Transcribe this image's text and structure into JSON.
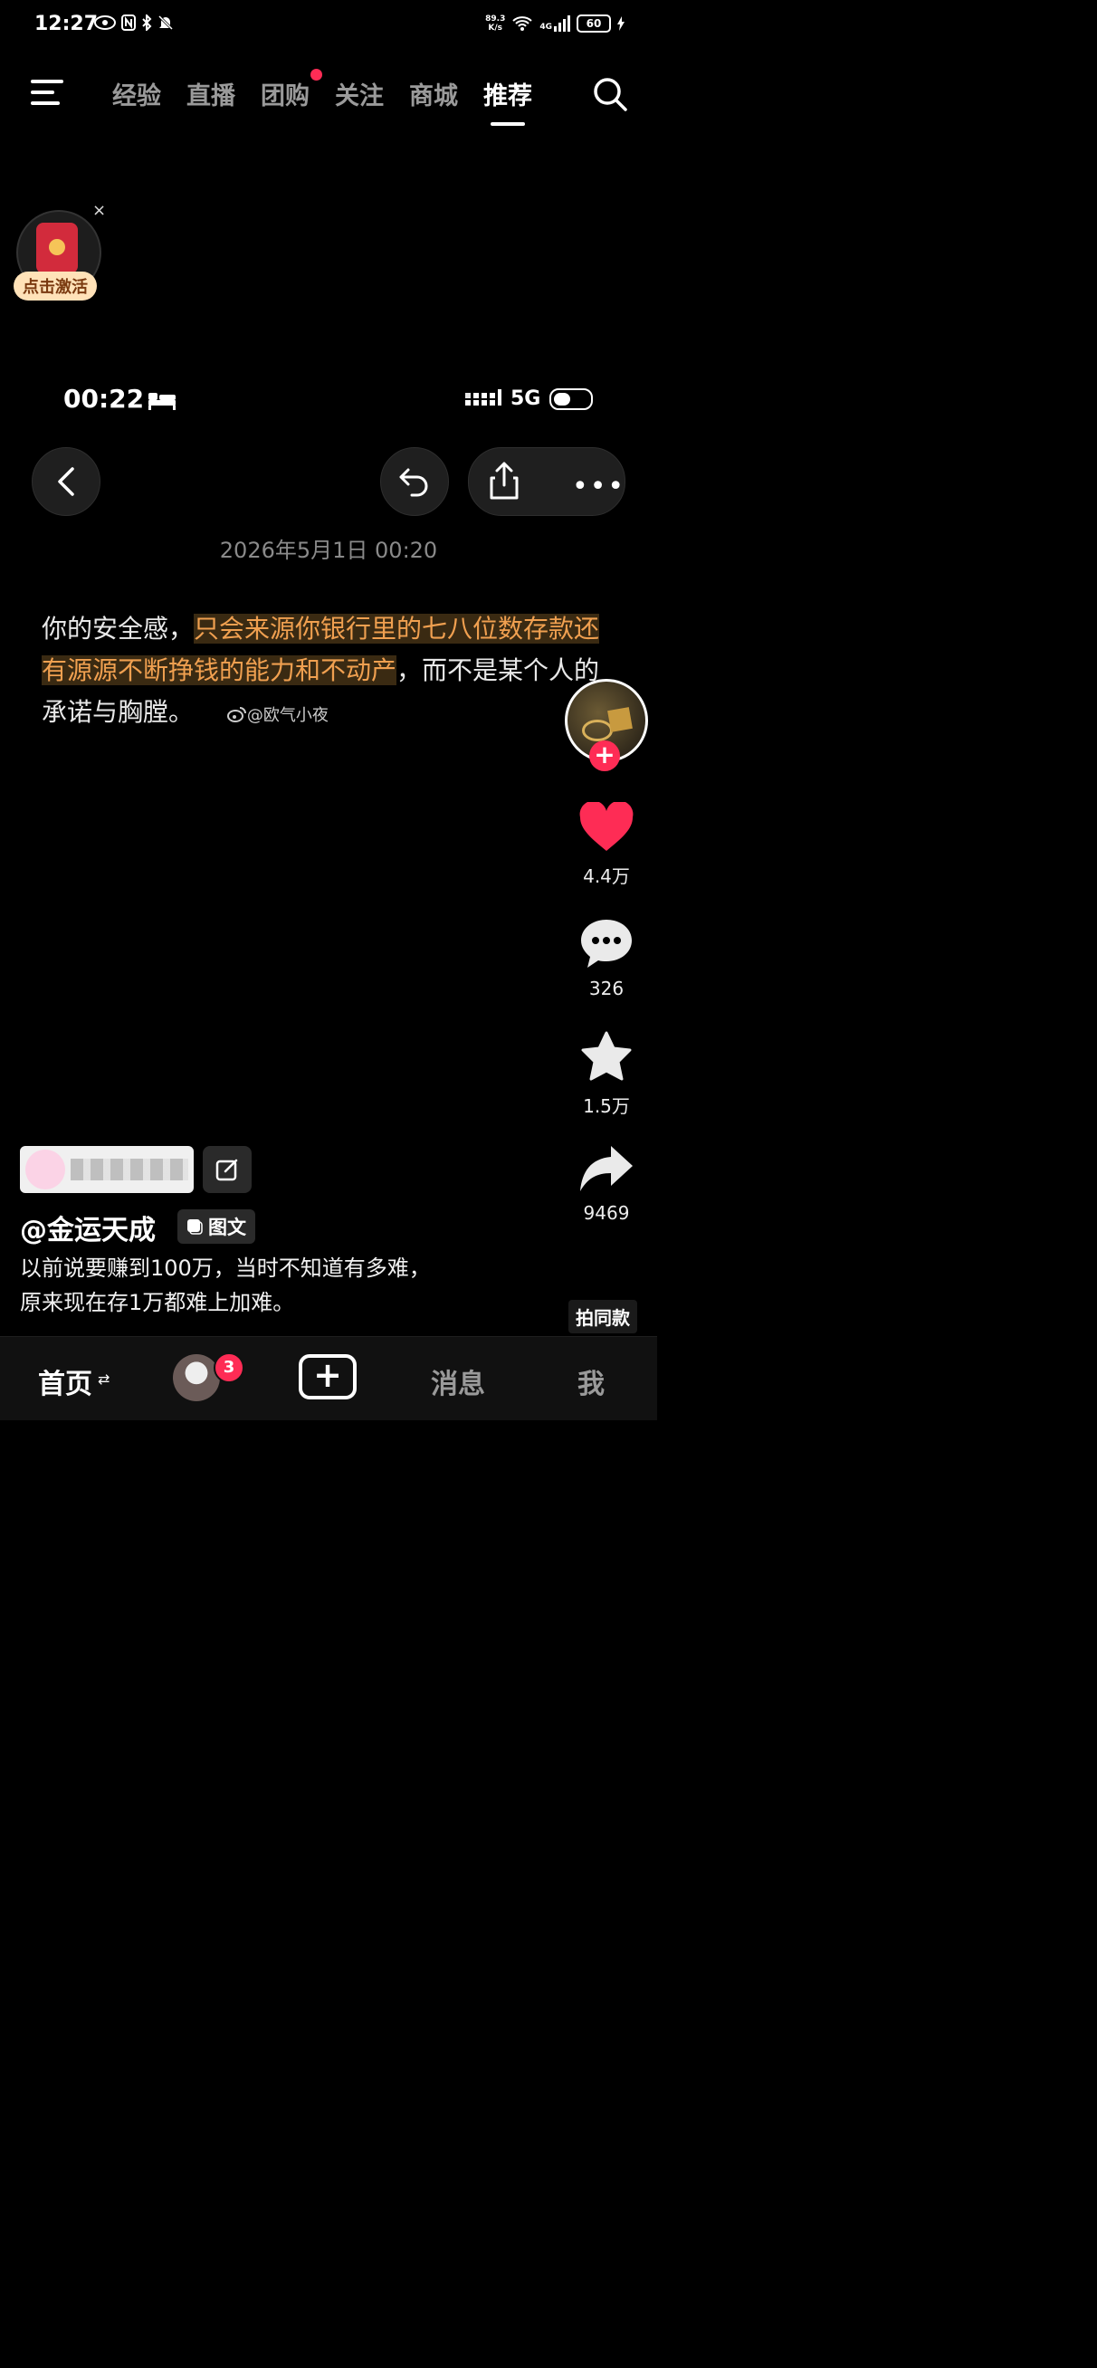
{
  "status_bar": {
    "time": "12:27",
    "net_speed_value": "89.3",
    "net_speed_unit": "K/s",
    "network": "4G",
    "battery": "60"
  },
  "top_nav": {
    "tabs": [
      {
        "label": "经验",
        "active": false
      },
      {
        "label": "直播",
        "active": false
      },
      {
        "label": "团购",
        "active": false,
        "dot": true
      },
      {
        "label": "关注",
        "active": false
      },
      {
        "label": "商城",
        "active": false
      },
      {
        "label": "推荐",
        "active": true
      }
    ]
  },
  "promo": {
    "label": "点击激活",
    "close": "×"
  },
  "post_image": {
    "time": "00:22",
    "network": "5G",
    "date": "2026年5月1日 00:20",
    "text_before": "你的安全感，",
    "text_highlight": "只会来源你银行里的七八位数存款还有源源不断挣钱的能力和不动产",
    "text_after": "，而不是某个人的承诺与胸膛。",
    "watermark": "@欧气小夜"
  },
  "rail": {
    "likes": "4.4万",
    "comments": "326",
    "favorites": "1.5万",
    "shares": "9469",
    "follow_symbol": "+"
  },
  "author": {
    "name": "@金运天成",
    "type_tag": "图文"
  },
  "description": {
    "line1": "以前说要赚到100万，当时不知道有多难，",
    "line2": "原来现在存1万都难上加难。"
  },
  "same_style": "拍同款",
  "bottom_nav": {
    "home": "首页",
    "home_arrows": "⇄",
    "friend_badge": "3",
    "plus": "+",
    "messages": "消息",
    "me": "我"
  },
  "colors": {
    "accent": "#fe2c55",
    "highlight_text": "#f0a050"
  }
}
